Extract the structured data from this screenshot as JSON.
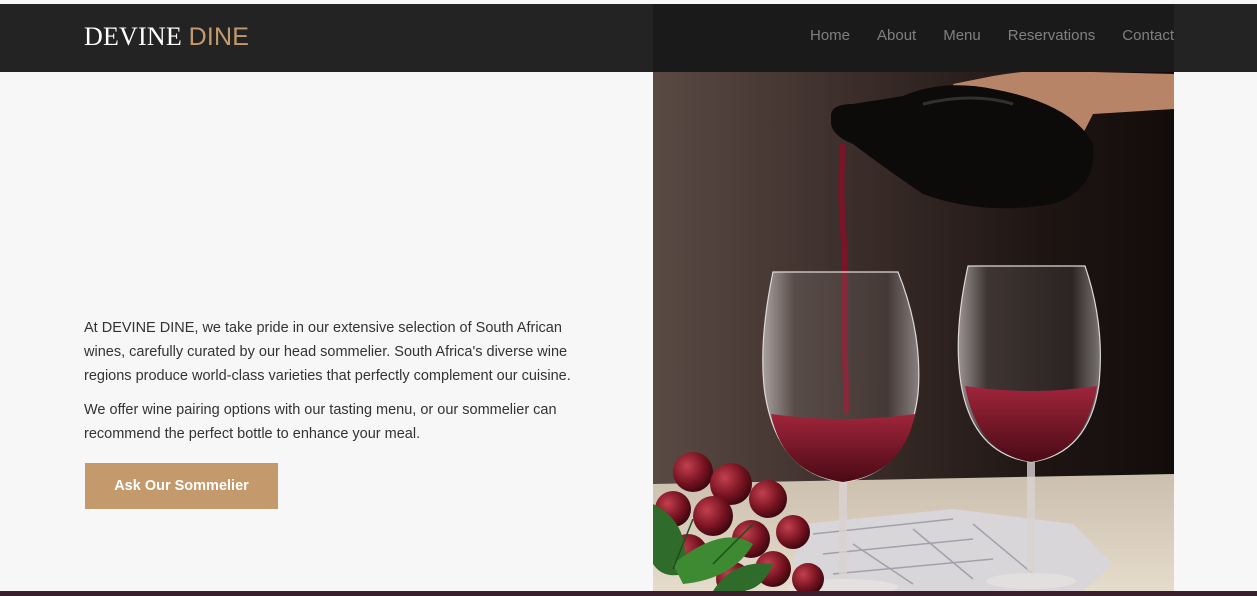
{
  "brand": {
    "name_primary": "DEVINE",
    "name_accent": "DINE",
    "accent_color": "#c49a6c"
  },
  "nav": {
    "items": [
      {
        "label": "Home"
      },
      {
        "label": "About"
      },
      {
        "label": "Menu"
      },
      {
        "label": "Reservations"
      },
      {
        "label": "Contact"
      }
    ]
  },
  "content": {
    "paragraph_1": "At DEVINE DINE, we take pride in our extensive selection of South African wines, carefully curated by our head sommelier. South Africa's diverse wine regions produce world-class varieties that perfectly complement our cuisine.",
    "paragraph_2": "We offer wine pairing options with our tasting menu, or our sommelier can recommend the perfect bottle to enhance your meal.",
    "cta_label": "Ask Our Sommelier"
  },
  "colors": {
    "navbar": "#232323",
    "background": "#f7f7f7",
    "body_text": "#333333",
    "button": "#c49a6c",
    "footer_strip": "#3a1f2d"
  }
}
